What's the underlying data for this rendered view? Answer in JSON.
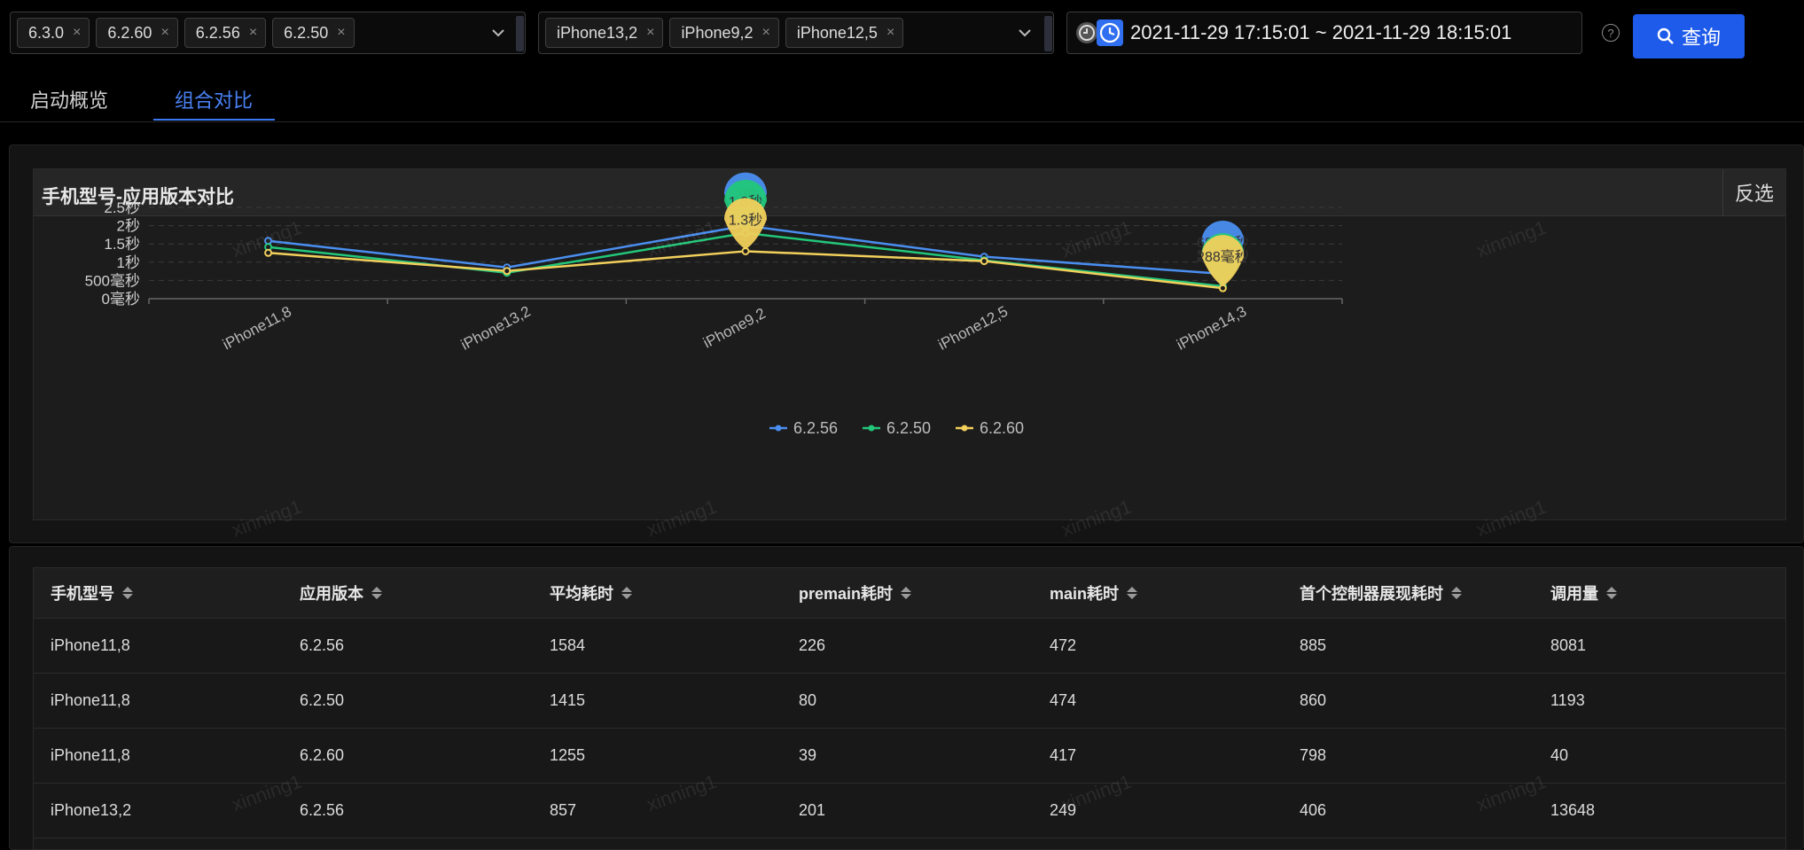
{
  "filters": {
    "versions": [
      "6.3.0",
      "6.2.60",
      "6.2.56",
      "6.2.50"
    ],
    "devices": [
      "iPhone13,2",
      "iPhone9,2",
      "iPhone12,5"
    ],
    "date_range": "2021-11-29 17:15:01 ~ 2021-11-29 18:15:01",
    "query_label": "查询",
    "remove_glyph": "×"
  },
  "tabs": [
    {
      "label": "启动概览",
      "active": false
    },
    {
      "label": "组合对比",
      "active": true
    }
  ],
  "panel": {
    "title": "手机型号-应用版本对比",
    "invert_label": "反选"
  },
  "watermark_text": "xinning1",
  "colors": {
    "accent": "#1f5bea",
    "series_blue": "#4a8ef0",
    "series_green": "#22c77a",
    "series_yellow": "#f2d05c"
  },
  "chart_data": {
    "type": "line",
    "title": "",
    "xlabel": "",
    "ylabel": "",
    "categories": [
      "iPhone11,8",
      "iPhone13,2",
      "iPhone9,2",
      "iPhone12,5",
      "iPhone14,3"
    ],
    "y_tick_labels": [
      "0毫秒",
      "500毫秒",
      "1秒",
      "1.5秒",
      "2秒",
      "2.5秒"
    ],
    "y_tick_values": [
      0,
      500,
      1000,
      1500,
      2000,
      2500
    ],
    "ylim": [
      0,
      2500
    ],
    "unit": "ms",
    "grid": true,
    "legend_position": "bottom-center",
    "series": [
      {
        "name": "6.2.56",
        "color": "#4a8ef0",
        "values": [
          1584,
          857,
          2000,
          1150,
          680
        ]
      },
      {
        "name": "6.2.50",
        "color": "#22c77a",
        "values": [
          1415,
          710,
          1800,
          1050,
          340
        ]
      },
      {
        "name": "6.2.60",
        "color": "#f2d05c",
        "values": [
          1255,
          760,
          1300,
          1030,
          288
        ]
      }
    ],
    "markers": [
      {
        "category": "iPhone9,2",
        "series": "6.2.56",
        "label": "2秒"
      },
      {
        "category": "iPhone9,2",
        "series": "6.2.50",
        "label": "1.8秒"
      },
      {
        "category": "iPhone9,2",
        "series": "6.2.60",
        "label": "1.3秒"
      },
      {
        "category": "iPhone14,3",
        "series": "6.2.56",
        "label": "680毫秒"
      },
      {
        "category": "iPhone14,3",
        "series": "6.2.50",
        "label": "340毫秒"
      },
      {
        "category": "iPhone14,3",
        "series": "6.2.60",
        "label": "288毫秒"
      }
    ]
  },
  "table": {
    "columns": [
      "手机型号",
      "应用版本",
      "平均耗时",
      "premain耗时",
      "main耗时",
      "首个控制器展现耗时",
      "调用量"
    ],
    "rows": [
      [
        "iPhone11,8",
        "6.2.56",
        "1584",
        "226",
        "472",
        "885",
        "8081"
      ],
      [
        "iPhone11,8",
        "6.2.50",
        "1415",
        "80",
        "474",
        "860",
        "1193"
      ],
      [
        "iPhone11,8",
        "6.2.60",
        "1255",
        "39",
        "417",
        "798",
        "40"
      ],
      [
        "iPhone13,2",
        "6.2.56",
        "857",
        "201",
        "249",
        "406",
        "13648"
      ]
    ]
  }
}
